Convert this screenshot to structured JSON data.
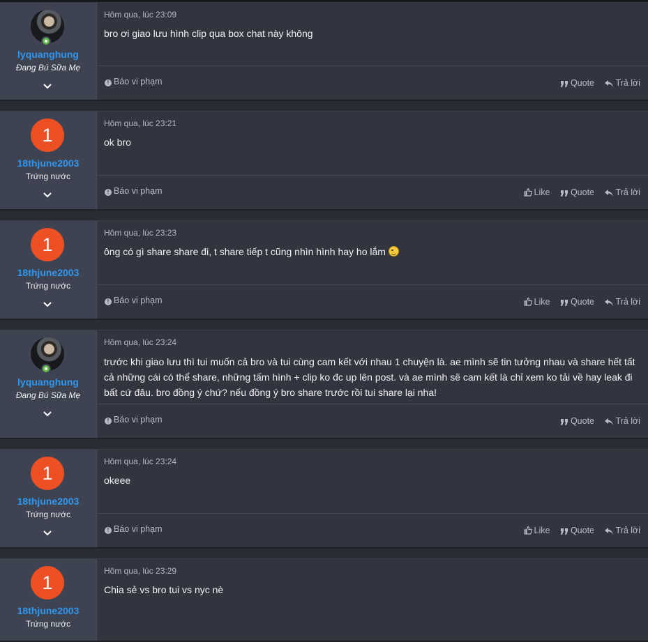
{
  "labels": {
    "report": "Báo vi phạm",
    "like": "Like",
    "quote": "Quote",
    "reply": "Trả lời"
  },
  "posts": [
    {
      "username": "lyquanghung",
      "user_title": "Đang Bú Sữa Mẹ",
      "avatar_letter": "",
      "date": "Hôm qua, lúc 23:09",
      "message": "bro ơi giao lưu hình clip qua box chat này không",
      "emoji": ""
    },
    {
      "username": "18thjune2003",
      "user_title": "Trứng nước",
      "avatar_letter": "1",
      "date": "Hôm qua, lúc 23:21",
      "message": "ok bro",
      "emoji": ""
    },
    {
      "username": "18thjune2003",
      "user_title": "Trứng nước",
      "avatar_letter": "1",
      "date": "Hôm qua, lúc 23:23",
      "message": "ông có gì share share đi, t share tiếp t cũng nhìn hình hay ho lắm",
      "emoji": "smirk-emoji"
    },
    {
      "username": "lyquanghung",
      "user_title": "Đang Bú Sữa Mẹ",
      "avatar_letter": "",
      "date": "Hôm qua, lúc 23:24",
      "message": "trước khi giao lưu thì tui muốn cả bro và tui cùng cam kết với nhau 1 chuyện là. ae mình sẽ tin tưởng nhau và share hết tất cả những cái có thể share, những tấm hình + clip ko đc up lên post. và ae mình sẽ cam kết là chỉ xem ko tải về hay leak đi bất cứ đâu. bro đồng ý chứ? nếu đồng ý bro share trước rồi tui share lại nha!",
      "emoji": ""
    },
    {
      "username": "18thjune2003",
      "user_title": "Trứng nước",
      "avatar_letter": "1",
      "date": "Hôm qua, lúc 23:24",
      "message": "okeee",
      "emoji": ""
    },
    {
      "username": "18thjune2003",
      "user_title": "Trứng nước",
      "avatar_letter": "1",
      "date": "Hôm qua, lúc 23:29",
      "message": "Chia sẻ vs bro tui vs nyc nè",
      "emoji": ""
    }
  ],
  "colors": {
    "background": "#292c33",
    "post_bg": "#32353f",
    "user_panel_bg": "#3e4352",
    "username": "#2f97ef",
    "avatar_letter_bg": "#ec5024",
    "online": "#63b84a"
  }
}
